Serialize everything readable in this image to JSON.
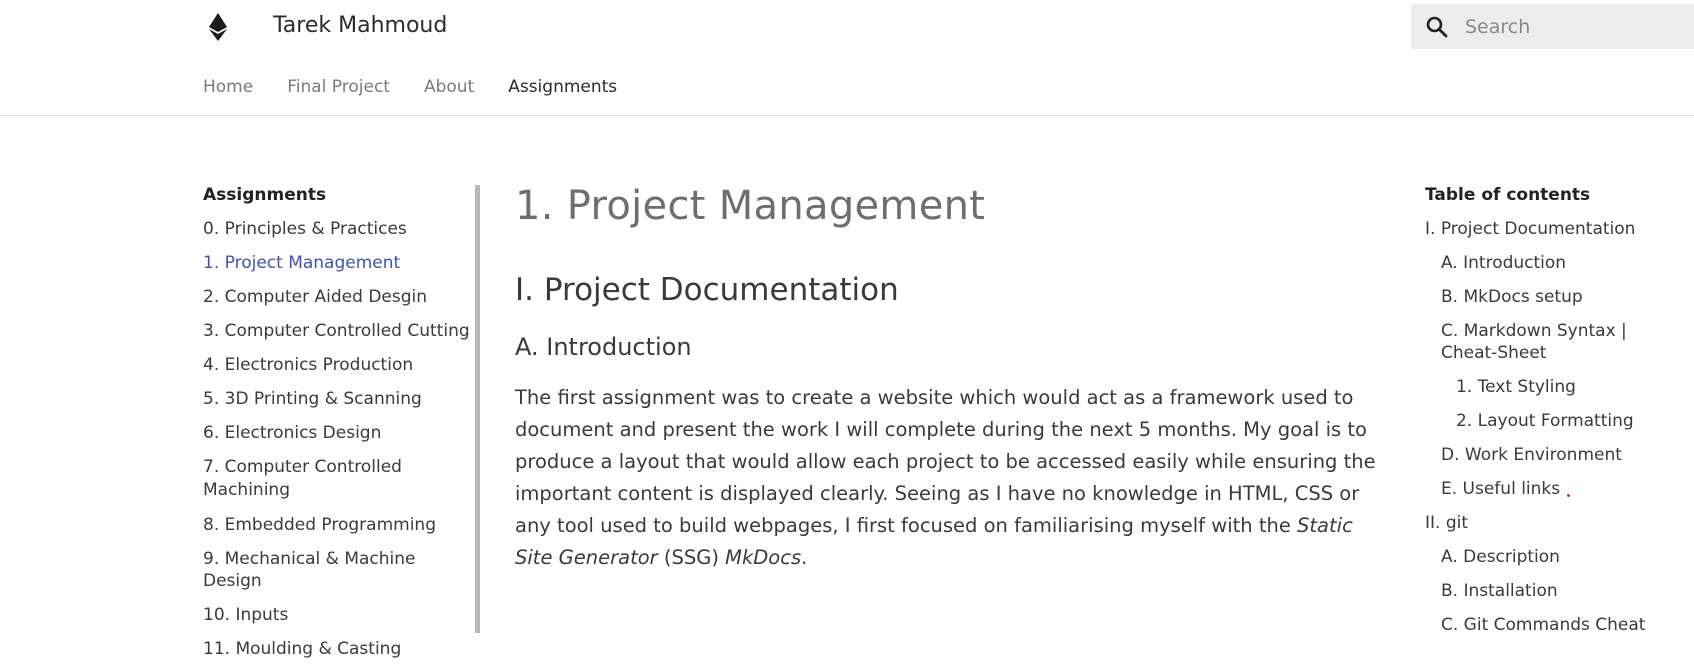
{
  "header": {
    "site_title": "Tarek Mahmoud",
    "logo_icon": "ethereum-icon",
    "search": {
      "placeholder": "Search",
      "value": ""
    },
    "tabs": [
      {
        "label": "Home",
        "active": false
      },
      {
        "label": "Final Project",
        "active": false
      },
      {
        "label": "About",
        "active": false
      },
      {
        "label": "Assignments",
        "active": true
      }
    ]
  },
  "sidebar": {
    "heading": "Assignments",
    "items": [
      {
        "label": "0. Principles & Practices",
        "active": false
      },
      {
        "label": "1. Project Management",
        "active": true
      },
      {
        "label": "2. Computer Aided Desgin",
        "active": false
      },
      {
        "label": "3. Computer Controlled Cutting",
        "active": false
      },
      {
        "label": "4. Electronics Production",
        "active": false
      },
      {
        "label": "5. 3D Printing & Scanning",
        "active": false
      },
      {
        "label": "6. Electronics Design",
        "active": false
      },
      {
        "label": "7. Computer Controlled Machining",
        "active": false
      },
      {
        "label": "8. Embedded Programming",
        "active": false
      },
      {
        "label": "9. Mechanical & Machine Design",
        "active": false
      },
      {
        "label": "10. Inputs",
        "active": false
      },
      {
        "label": "11. Moulding & Casting",
        "active": false
      }
    ]
  },
  "main": {
    "title": "1. Project Management",
    "section_heading": "I. Project Documentation",
    "subsection_heading": "A. Introduction",
    "paragraph": {
      "text_before": "The first assignment was to create a website which would act as a framework used to document and present the work I will complete during the next 5 months. My goal is to produce a layout that would allow each project to be accessed easily while ensuring the important content is displayed clearly. Seeing as I have no knowledge in HTML, CSS or any tool used to build webpages, I first focused on familiarising myself with the ",
      "em1": "Static Site Generator",
      "text_middle": " (SSG) ",
      "em2": "MkDocs",
      "text_after": "."
    }
  },
  "toc": {
    "heading": "Table of contents",
    "items": [
      {
        "label": "I. Project Documentation",
        "level": 1
      },
      {
        "label": "A. Introduction",
        "level": 2
      },
      {
        "label": "B. MkDocs setup",
        "level": 2
      },
      {
        "label": "C. Markdown Syntax | Cheat-Sheet",
        "level": 2
      },
      {
        "label": "1. Text Styling",
        "level": 3
      },
      {
        "label": "2. Layout Formatting",
        "level": 3
      },
      {
        "label": "D. Work Environment",
        "level": 2
      },
      {
        "label": "E. Useful links",
        "level": 2
      },
      {
        "label": "II. git",
        "level": 1
      },
      {
        "label": "A. Description",
        "level": 2
      },
      {
        "label": "B. Installation",
        "level": 2
      },
      {
        "label": "C. Git Commands Cheat",
        "level": 2
      }
    ]
  },
  "colors": {
    "accent": "#4051b5",
    "text": "#3a3a3a",
    "muted": "#7a7a7a",
    "search_bg": "#ececec"
  }
}
